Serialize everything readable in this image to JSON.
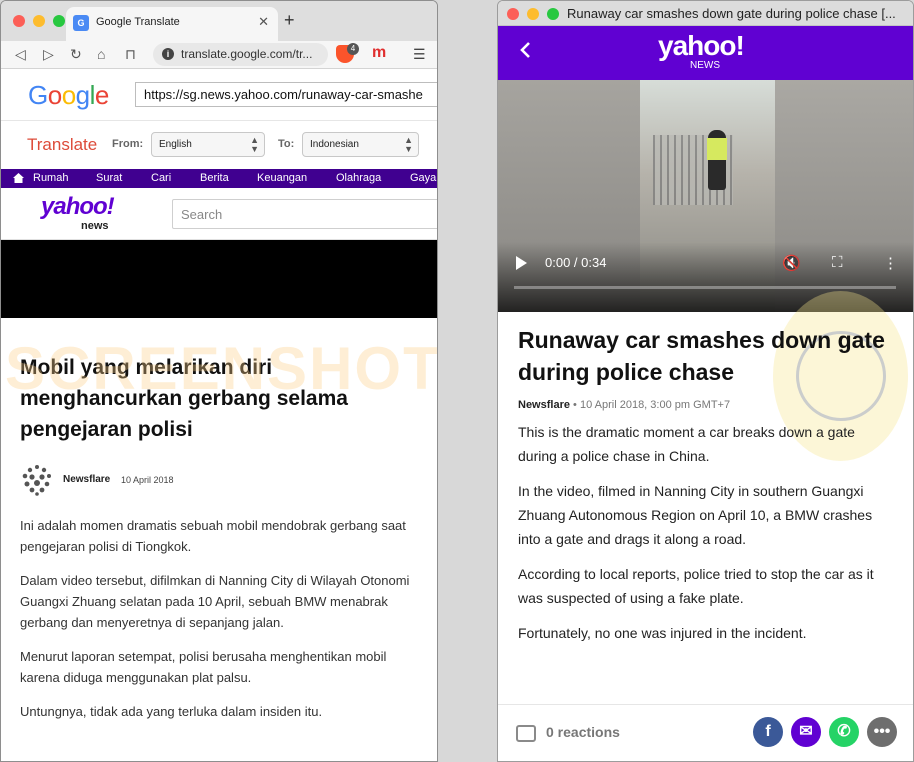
{
  "left_browser": {
    "tab_title": "Google Translate",
    "url": "translate.google.com/tr...",
    "extension_badge": "4",
    "google_translate": {
      "logo": "Google",
      "url_field": "https://sg.news.yahoo.com/runaway-car-smashe",
      "translate_label": "Translate",
      "from_label": "From:",
      "from_lang": "English",
      "to_label": "To:",
      "to_lang": "Indonesian"
    },
    "yahoo_nav": [
      "Rumah",
      "Surat",
      "Cari",
      "Berita",
      "Keuangan",
      "Olahraga",
      "Gaya"
    ],
    "yahoo_logo": "yahoo!",
    "yahoo_sub": "news",
    "search_placeholder": "Search",
    "article": {
      "title": "Mobil yang melarikan diri menghancurkan gerbang selama pengejaran polisi",
      "source": "Newsflare",
      "date": "10 April 2018",
      "paragraphs": [
        "Ini adalah momen dramatis sebuah mobil mendobrak gerbang saat pengejaran polisi di Tiongkok.",
        "Dalam video tersebut, difilmkan di Nanning City di Wilayah Otonomi Guangxi Zhuang selatan pada 10 April, sebuah BMW menabrak gerbang dan menyeretnya di sepanjang jalan.",
        "Menurut laporan setempat, polisi berusaha menghentikan mobil karena diduga menggunakan plat palsu.",
        "Untungnya, tidak ada yang terluka dalam insiden itu."
      ]
    },
    "watermark": "SCREENSHOT BY"
  },
  "right_window": {
    "title": "Runaway car smashes down gate during police chase [...",
    "yahoo_logo": "yahoo!",
    "yahoo_sub": "NEWS",
    "video": {
      "time": "0:00 / 0:34",
      "progress": 0.0
    },
    "article": {
      "headline": "Runaway car smashes down gate during police chase",
      "source": "Newsflare",
      "separator": "•",
      "date": "10 April 2018, 3:00 pm GMT+7",
      "paragraphs": [
        "This is the dramatic moment a car breaks down a gate during a police chase in China.",
        "In the video, filmed in Nanning City in southern Guangxi Zhuang Autonomous Region on April 10, a BMW crashes into a gate and drags it along a road.",
        "According to local reports, police tried to stop the car as it was suspected of using a fake plate.",
        "Fortunately, no one was injured in the incident."
      ]
    },
    "reactions": "0 reactions",
    "share_colors": {
      "facebook": "#3b5998",
      "mail": "#6001d2",
      "whatsapp": "#25d366",
      "more": "#6e6e6e"
    }
  }
}
